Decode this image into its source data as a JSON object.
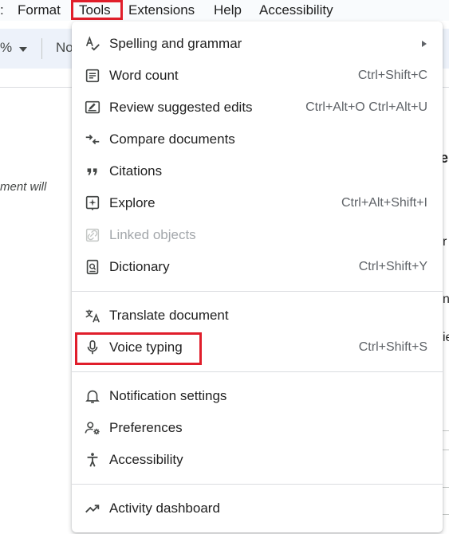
{
  "menubar": {
    "items": [
      ":",
      "Format",
      "Tools",
      "Extensions",
      "Help",
      "Accessibility"
    ]
  },
  "toolbar": {
    "zoom_fragment": "%",
    "style_fragment": "No"
  },
  "document": {
    "left_fragment": "ment will",
    "right_fragments": [
      "e",
      "r",
      "no",
      "ie"
    ]
  },
  "tools_menu": {
    "items": [
      {
        "label": "Spelling and grammar",
        "shortcut": "",
        "icon": "spellcheck-icon",
        "submenu": true
      },
      {
        "label": "Word count",
        "shortcut": "Ctrl+Shift+C",
        "icon": "word-count-icon"
      },
      {
        "label": "Review suggested edits",
        "shortcut": "Ctrl+Alt+O Ctrl+Alt+U",
        "icon": "review-edits-icon"
      },
      {
        "label": "Compare documents",
        "shortcut": "",
        "icon": "compare-icon"
      },
      {
        "label": "Citations",
        "shortcut": "",
        "icon": "quote-icon"
      },
      {
        "label": "Explore",
        "shortcut": "Ctrl+Alt+Shift+I",
        "icon": "explore-icon"
      },
      {
        "label": "Linked objects",
        "shortcut": "",
        "icon": "link-icon",
        "disabled": true
      },
      {
        "label": "Dictionary",
        "shortcut": "Ctrl+Shift+Y",
        "icon": "dictionary-icon"
      },
      {
        "label": "Translate document",
        "shortcut": "",
        "icon": "translate-icon"
      },
      {
        "label": "Voice typing",
        "shortcut": "Ctrl+Shift+S",
        "icon": "microphone-icon"
      },
      {
        "label": "Notification settings",
        "shortcut": "",
        "icon": "bell-icon"
      },
      {
        "label": "Preferences",
        "shortcut": "",
        "icon": "preferences-icon"
      },
      {
        "label": "Accessibility",
        "shortcut": "",
        "icon": "accessibility-icon"
      },
      {
        "label": "Activity dashboard",
        "shortcut": "",
        "icon": "trending-icon"
      }
    ]
  },
  "colors": {
    "highlight": "#e01e2b",
    "menu_text": "#1f1f1f",
    "shortcut_text": "#5f6368",
    "disabled_text": "#a3a7ab"
  }
}
